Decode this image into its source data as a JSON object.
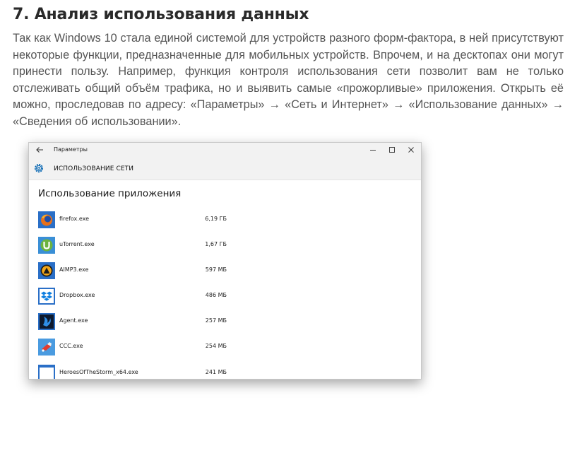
{
  "article": {
    "title": "7. Анализ использования данных",
    "body": "Так как Windows 10 стала единой системой для устройств разного форм-фактора, в ней присутствуют некоторые функции, предназначенные для мобильных устройств. Впрочем, и на десктопах они могут принести пользу. Например, функция контроля использования сети позволит вам не только отслеживать общий объём трафика, но и выявить самые «прожорливые» приложения. Открыть её можно, проследовав по адресу: «Параметры» → «Сеть и Интернет» → «Использование данных» → «Сведения об использовании»."
  },
  "window": {
    "title": "Параметры",
    "header": "ИСПОЛЬЗОВАНИЕ СЕТИ",
    "section_title": "Использование приложения",
    "accent_color": "#0063b1",
    "apps": [
      {
        "name": "firefox.exe",
        "usage": "6,19 ГБ",
        "icon": "firefox-icon"
      },
      {
        "name": "uTorrent.exe",
        "usage": "1,67 ГБ",
        "icon": "utorrent-icon"
      },
      {
        "name": "AIMP3.exe",
        "usage": "597 МБ",
        "icon": "aimp-icon"
      },
      {
        "name": "Dropbox.exe",
        "usage": "486 МБ",
        "icon": "dropbox-icon"
      },
      {
        "name": "Agent.exe",
        "usage": "257 МБ",
        "icon": "agent-icon"
      },
      {
        "name": "CCC.exe",
        "usage": "254 МБ",
        "icon": "ccc-icon"
      },
      {
        "name": "HeroesOfTheStorm_x64.exe",
        "usage": "241 МБ",
        "icon": "heroes-icon"
      }
    ]
  }
}
